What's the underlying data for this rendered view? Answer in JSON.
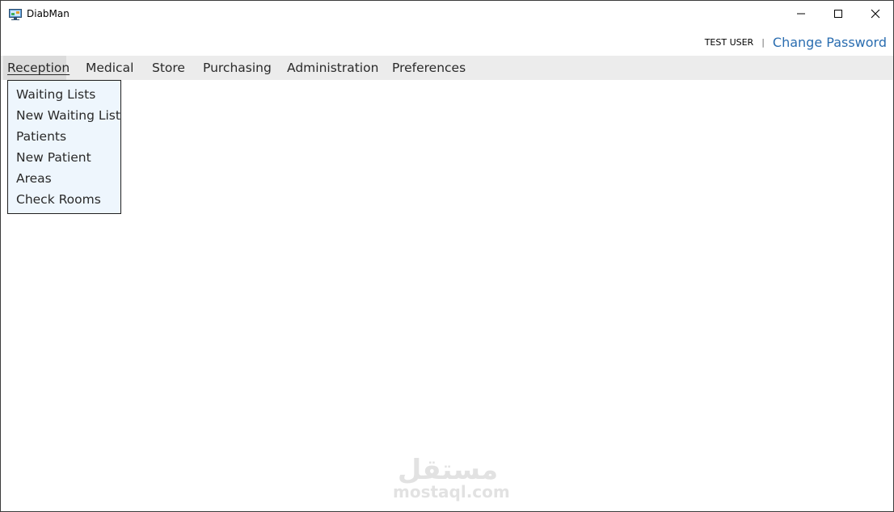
{
  "window": {
    "title": "DiabMan",
    "controls": {
      "minimize": "minimize-icon",
      "maximize": "maximize-icon",
      "close": "close-icon"
    }
  },
  "userbar": {
    "username": "TEST USER",
    "separator": "|",
    "change_password": "Change Password"
  },
  "menu": {
    "items": [
      {
        "label": "Reception",
        "active": true
      },
      {
        "label": "Medical"
      },
      {
        "label": "Store"
      },
      {
        "label": "Purchasing"
      },
      {
        "label": "Administration"
      },
      {
        "label": "Preferences"
      }
    ]
  },
  "dropdown": {
    "items": [
      {
        "label": "Waiting Lists"
      },
      {
        "label": "New Waiting List"
      },
      {
        "label": "Patients"
      },
      {
        "label": "New Patient"
      },
      {
        "label": "Areas"
      },
      {
        "label": "Check Rooms"
      }
    ]
  },
  "watermark": {
    "text": "mostaql.com",
    "arabic": "مستقل"
  },
  "colors": {
    "link": "#2a6db0",
    "menubar": "#ececec",
    "dropdown_bg": "#eef6fd"
  }
}
